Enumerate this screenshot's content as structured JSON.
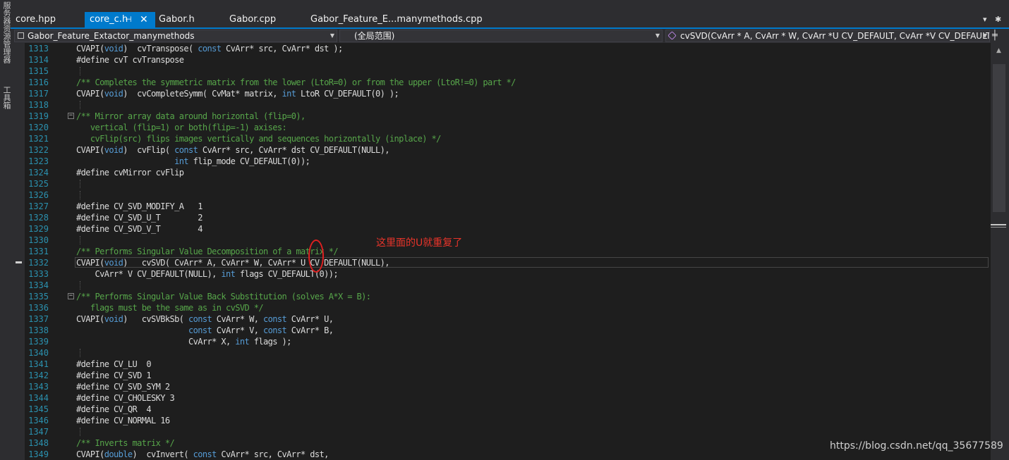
{
  "sidebar": {
    "labels": [
      "服务器资源管理器",
      "工具箱"
    ]
  },
  "tabs": [
    {
      "label": "core.hpp",
      "active": false
    },
    {
      "label": "core_c.h",
      "active": true
    },
    {
      "label": "Gabor.h",
      "active": false
    },
    {
      "label": "Gabor.cpp",
      "active": false
    },
    {
      "label": "Gabor_Feature_E...manymethods.cpp",
      "active": false
    }
  ],
  "navbar": {
    "project": "Gabor_Feature_Extactor_manymethods",
    "scope": "(全局范围)",
    "member": "cvSVD(CvArr * A, CvArr * W, CvArr *U CV_DEFAULT, CvArr *V CV_DEFAULT"
  },
  "editor": {
    "lines": [
      {
        "n": "1313",
        "tokens": [
          [
            "CVAPI(",
            "t"
          ],
          [
            "void",
            "k"
          ],
          [
            ")  cvTranspose( ",
            "t"
          ],
          [
            "const",
            "k"
          ],
          [
            " CvArr* src, CvArr* dst );",
            "t"
          ]
        ]
      },
      {
        "n": "1314",
        "tokens": [
          [
            "#define cvT cvTranspose",
            "t"
          ]
        ]
      },
      {
        "n": "1315",
        "tokens": []
      },
      {
        "n": "1316",
        "tokens": [
          [
            "/** Completes the symmetric matrix from the lower (LtoR=0) or from the upper (LtoR!=0) part */",
            "c"
          ]
        ]
      },
      {
        "n": "1317",
        "tokens": [
          [
            "CVAPI(",
            "t"
          ],
          [
            "void",
            "k"
          ],
          [
            ")  cvCompleteSymm( CvMat* matrix, ",
            "t"
          ],
          [
            "int",
            "k"
          ],
          [
            " LtoR CV_DEFAULT(0) );",
            "t"
          ]
        ]
      },
      {
        "n": "1318",
        "tokens": []
      },
      {
        "n": "1319",
        "fold": true,
        "tokens": [
          [
            "/** Mirror array data around horizontal (flip=0),",
            "c"
          ]
        ]
      },
      {
        "n": "1320",
        "tokens": [
          [
            "   vertical (flip=1) or both(flip=-1) axises:",
            "c"
          ]
        ]
      },
      {
        "n": "1321",
        "tokens": [
          [
            "   cvFlip(src) flips images vertically and sequences horizontally (inplace) */",
            "c"
          ]
        ]
      },
      {
        "n": "1322",
        "tokens": [
          [
            "CVAPI(",
            "t"
          ],
          [
            "void",
            "k"
          ],
          [
            ")  cvFlip( ",
            "t"
          ],
          [
            "const",
            "k"
          ],
          [
            " CvArr* src, CvArr* dst CV_DEFAULT(NULL),",
            "t"
          ]
        ]
      },
      {
        "n": "1323",
        "tokens": [
          [
            "                     ",
            "t"
          ],
          [
            "int",
            "k"
          ],
          [
            " flip_mode CV_DEFAULT(0));",
            "t"
          ]
        ]
      },
      {
        "n": "1324",
        "tokens": [
          [
            "#define cvMirror cvFlip",
            "t"
          ]
        ]
      },
      {
        "n": "1325",
        "tokens": []
      },
      {
        "n": "1326",
        "tokens": []
      },
      {
        "n": "1327",
        "tokens": [
          [
            "#define CV_SVD_MODIFY_A   1",
            "t"
          ]
        ]
      },
      {
        "n": "1328",
        "tokens": [
          [
            "#define CV_SVD_U_T        2",
            "t"
          ]
        ]
      },
      {
        "n": "1329",
        "tokens": [
          [
            "#define CV_SVD_V_T        4",
            "t"
          ]
        ]
      },
      {
        "n": "1330",
        "tokens": []
      },
      {
        "n": "1331",
        "tokens": [
          [
            "/** Performs Singular Value Decomposition of a matrix */",
            "c"
          ]
        ]
      },
      {
        "n": "1332",
        "tokens": [
          [
            "CVAPI(",
            "t"
          ],
          [
            "void",
            "k"
          ],
          [
            ")   cvSVD( CvArr* A, CvArr* W, CvArr* U CV_DEFAULT(NULL),",
            "t"
          ]
        ]
      },
      {
        "n": "1333",
        "tokens": [
          [
            "    CvArr* V CV_DEFAULT(NULL), ",
            "t"
          ],
          [
            "int",
            "k"
          ],
          [
            " flags CV_DEFAULT(0));",
            "t"
          ]
        ]
      },
      {
        "n": "1334",
        "tokens": []
      },
      {
        "n": "1335",
        "fold": true,
        "tokens": [
          [
            "/** Performs Singular Value Back Substitution (solves A*X = B):",
            "c"
          ]
        ]
      },
      {
        "n": "1336",
        "tokens": [
          [
            "   flags must be the same as in cvSVD */",
            "c"
          ]
        ]
      },
      {
        "n": "1337",
        "tokens": [
          [
            "CVAPI(",
            "t"
          ],
          [
            "void",
            "k"
          ],
          [
            ")   cvSVBkSb( ",
            "t"
          ],
          [
            "const",
            "k"
          ],
          [
            " CvArr* W, ",
            "t"
          ],
          [
            "const",
            "k"
          ],
          [
            " CvArr* U,",
            "t"
          ]
        ]
      },
      {
        "n": "1338",
        "tokens": [
          [
            "                        ",
            "t"
          ],
          [
            "const",
            "k"
          ],
          [
            " CvArr* V, ",
            "t"
          ],
          [
            "const",
            "k"
          ],
          [
            " CvArr* B,",
            "t"
          ]
        ]
      },
      {
        "n": "1339",
        "tokens": [
          [
            "                        CvArr* X, ",
            "t"
          ],
          [
            "int",
            "k"
          ],
          [
            " flags );",
            "t"
          ]
        ]
      },
      {
        "n": "1340",
        "tokens": []
      },
      {
        "n": "1341",
        "tokens": [
          [
            "#define CV_LU  0",
            "t"
          ]
        ]
      },
      {
        "n": "1342",
        "tokens": [
          [
            "#define CV_SVD 1",
            "t"
          ]
        ]
      },
      {
        "n": "1343",
        "tokens": [
          [
            "#define CV_SVD_SYM 2",
            "t"
          ]
        ]
      },
      {
        "n": "1344",
        "tokens": [
          [
            "#define CV_CHOLESKY 3",
            "t"
          ]
        ]
      },
      {
        "n": "1345",
        "tokens": [
          [
            "#define CV_QR  4",
            "t"
          ]
        ]
      },
      {
        "n": "1346",
        "tokens": [
          [
            "#define CV_NORMAL 16",
            "t"
          ]
        ]
      },
      {
        "n": "1347",
        "tokens": []
      },
      {
        "n": "1348",
        "tokens": [
          [
            "/** Inverts matrix */",
            "c"
          ]
        ]
      },
      {
        "n": "1349",
        "tokens": [
          [
            "CVAPI(",
            "t"
          ],
          [
            "double",
            "k"
          ],
          [
            ")  cvInvert( ",
            "t"
          ],
          [
            "const",
            "k"
          ],
          [
            " CvArr* src, CvArr* dst,",
            "t"
          ]
        ]
      }
    ]
  },
  "annotation": "这里面的U就重复了",
  "watermark": "https://blog.csdn.net/qq_35677589",
  "colors": {
    "comment": "#57a64a",
    "keyword": "#569cd6",
    "text": "#dcdcdc",
    "line_number": "#2b91af",
    "accent": "#007acc",
    "annotation": "#e8342a"
  }
}
